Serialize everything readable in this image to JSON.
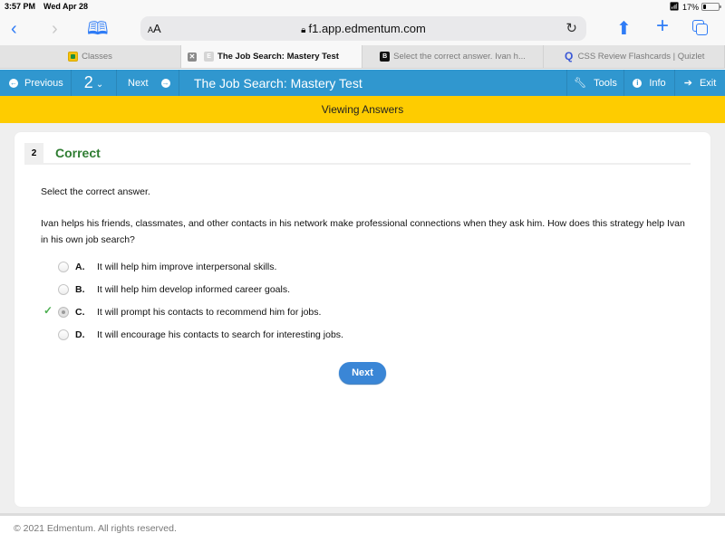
{
  "status_bar": {
    "time": "3:57 PM",
    "date": "Wed Apr 28",
    "battery": "17%",
    "battery_level": 0.17
  },
  "browser": {
    "text_size_label": "AA",
    "url": "f1.app.edmentum.com",
    "tabs": [
      {
        "label": "Classes",
        "favicon": "google-classroom-icon",
        "active": false
      },
      {
        "label": "The Job Search: Mastery Test",
        "favicon": "E",
        "active": true
      },
      {
        "label": "Select the correct answer. Ivan h...",
        "favicon": "B",
        "active": false
      },
      {
        "label": "CSS Review Flashcards | Quizlet",
        "favicon": "Q",
        "active": false
      }
    ]
  },
  "nav": {
    "previous_label": "Previous",
    "question_number": "2",
    "next_label": "Next",
    "title": "The Job Search: Mastery Test",
    "tools_label": "Tools",
    "info_label": "Info",
    "exit_label": "Exit",
    "color": "#3097cf"
  },
  "banner": {
    "text": "Viewing Answers",
    "color": "#fecc00"
  },
  "question": {
    "number": "2",
    "status": "Correct",
    "status_color": "#2f7d32",
    "instruction": "Select the correct answer.",
    "prompt": "Ivan helps his friends, classmates, and other contacts in his network make professional connections when they ask him. How does this strategy help Ivan in his own job search?",
    "choices": [
      {
        "letter": "A.",
        "text": "It will help him improve interpersonal skills.",
        "selected": false,
        "correct": false
      },
      {
        "letter": "B.",
        "text": "It will help him develop informed career goals.",
        "selected": false,
        "correct": false
      },
      {
        "letter": "C.",
        "text": "It will prompt his contacts to recommend him for jobs.",
        "selected": true,
        "correct": true
      },
      {
        "letter": "D.",
        "text": "It will encourage his contacts to search for interesting jobs.",
        "selected": false,
        "correct": false
      }
    ],
    "check_mark": "✓",
    "next_button": "Next"
  },
  "footer": {
    "copyright": "© 2021 Edmentum. All rights reserved."
  }
}
